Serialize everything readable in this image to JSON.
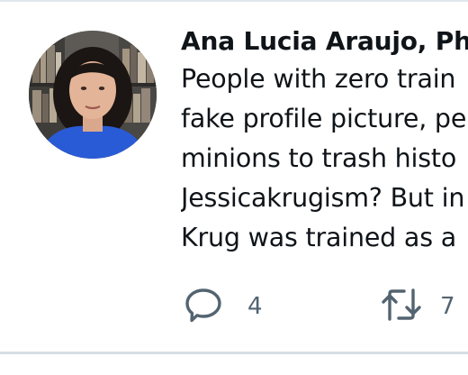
{
  "tweet": {
    "author_name": "Ana Lucia Araujo, Ph",
    "text_lines": [
      "People with zero train",
      "fake profile picture, pe",
      "minions to trash histo",
      "Jessicakrugism? But in",
      "Krug was trained as a"
    ],
    "reply_icon": "reply-bubble-icon",
    "reply_count": "4",
    "retweet_icon": "retweet-arrows-icon",
    "retweet_count": "7"
  },
  "colors": {
    "text": "#0f1419",
    "secondary": "#536471",
    "divider": "#e1e8ed"
  }
}
